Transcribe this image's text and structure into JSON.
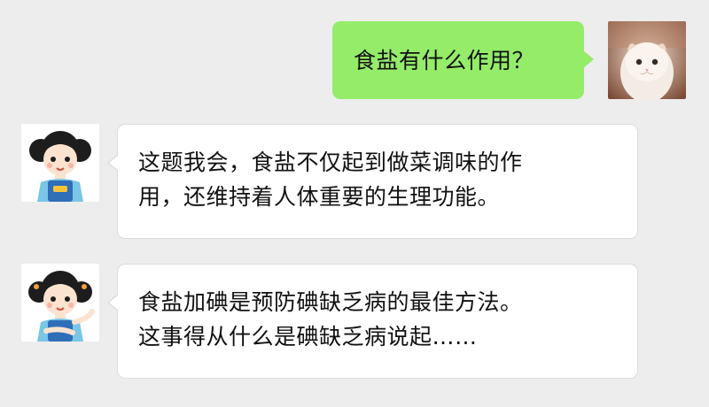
{
  "messages": [
    {
      "sender": "self",
      "avatar": "kitten-photo-avatar",
      "lines": [
        "食盐有什么作用？"
      ]
    },
    {
      "sender": "other",
      "avatar": "cartoon-girl-avatar",
      "lines": [
        "这题我会，食盐不仅起到做菜调味的作",
        "用，还维持着人体重要的生理功能。"
      ]
    },
    {
      "sender": "other",
      "avatar": "cartoon-girl-avatar",
      "lines": [
        "食盐加碘是预防碘缺乏病的最佳方法。",
        "这事得从什么是碘缺乏病说起……"
      ]
    }
  ],
  "colors": {
    "background": "#ededed",
    "self_bubble": "#95ec69",
    "other_bubble": "#ffffff"
  }
}
